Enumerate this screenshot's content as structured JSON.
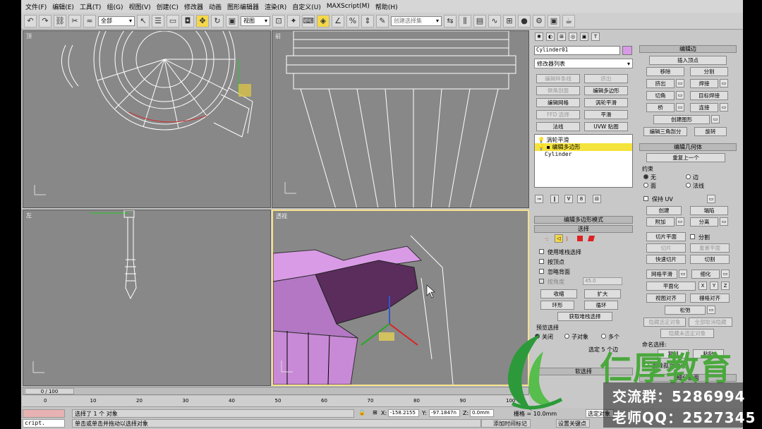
{
  "menu": [
    "文件(F)",
    "编辑(E)",
    "工具(T)",
    "组(G)",
    "视图(V)",
    "创建(C)",
    "修改器",
    "动画",
    "图形编辑器",
    "渲染(R)",
    "自定义(U)",
    "MAXScript(M)",
    "帮助(H)"
  ],
  "toolbar": {
    "filter": "全部",
    "view": "视图",
    "named_sel": "创建选择集"
  },
  "viewports": {
    "top": "顶",
    "front": "前",
    "left": "左",
    "persp": "透视"
  },
  "modifier": {
    "object_name": "Cylinder01",
    "list_label": "修改器列表",
    "buttons": [
      "编辑样条线",
      "挤出",
      "倒角剖面",
      "编辑多边形",
      "编辑网格",
      "涡轮平滑",
      "FFD 选择",
      "平滑",
      "法线",
      "UVW 贴图"
    ],
    "stack": [
      "涡轮平滑",
      "编辑多边形",
      "Cylinder"
    ],
    "edit_mode": "编辑多边形模式",
    "selection": "选择",
    "use_stack": "使用堆栈选择",
    "by_vertex": "按顶点",
    "ignore_back": "忽略背面",
    "by_angle": "按角度",
    "angle_val": "45.0",
    "shrink": "收缩",
    "grow": "扩大",
    "ring": "环形",
    "loop": "循环",
    "get_stack": "获取堆栈选择",
    "preview": "预览选择",
    "off": "关闭",
    "sub": "子对象",
    "multi": "多个",
    "selected": "选定 5 个边",
    "soft_sel": "软选择"
  },
  "edit_edges": {
    "title": "编辑边",
    "insert_vertex": "插入顶点",
    "remove": "移除",
    "split": "分割",
    "extrude": "挤出",
    "weld": "焊接",
    "chamfer": "切角",
    "target_weld": "目标焊接",
    "bridge": "桥",
    "connect": "连接",
    "create_shape": "创建图形",
    "edit_tri": "编辑三角剖分",
    "turn": "旋转"
  },
  "edit_geom": {
    "title": "编辑几何体",
    "repeat": "重复上一个",
    "constraint": "约束",
    "none": "无",
    "edge": "边",
    "face": "面",
    "normal": "法线",
    "preserve_uv": "保持 UV",
    "create": "创建",
    "collapse": "塌陷",
    "attach": "附加",
    "detach": "分离",
    "slice_plane": "切片平面",
    "split": "分割",
    "slice": "切片",
    "reset_plane": "重置平面",
    "quickslice": "快速切片",
    "cut": "切割",
    "meshsmooth": "网格平滑",
    "tessellate": "细化",
    "planarize": "平面化",
    "x": "X",
    "y": "Y",
    "z": "Z",
    "view_align": "视图对齐",
    "grid_align": "栅格对齐",
    "relax": "松弛",
    "hide_sel": "隐藏选定对象",
    "unhide_all": "全部取消隐藏",
    "hide_unsel": "隐藏未选定对象",
    "named_sel": "命名选择:",
    "copy": "复制",
    "paste": "粘贴",
    "del_iso": "删除孤立顶点",
    "subdiv": "细分曲面"
  },
  "timeline": {
    "frame": "0 / 100",
    "ticks": [
      "0",
      "10",
      "20",
      "30",
      "40",
      "50",
      "60",
      "70",
      "80",
      "90",
      "100"
    ]
  },
  "status": {
    "selected": "选择了 1 个 对象",
    "hint": "单击或单击并拖动以选择对象",
    "script": "cript.",
    "x": "-158.2155",
    "y": "-97.1847n",
    "z": "0.0mm",
    "grid": "栅格 = 10.0mm",
    "add_time_tag": "添加时间标记",
    "set_key": "设置关键点",
    "sel_obj": "选定对象"
  },
  "watermark": {
    "brand": "仁厚教育",
    "group": "交流群：5286994",
    "teacher_qq": "老师QQ：2527345"
  }
}
